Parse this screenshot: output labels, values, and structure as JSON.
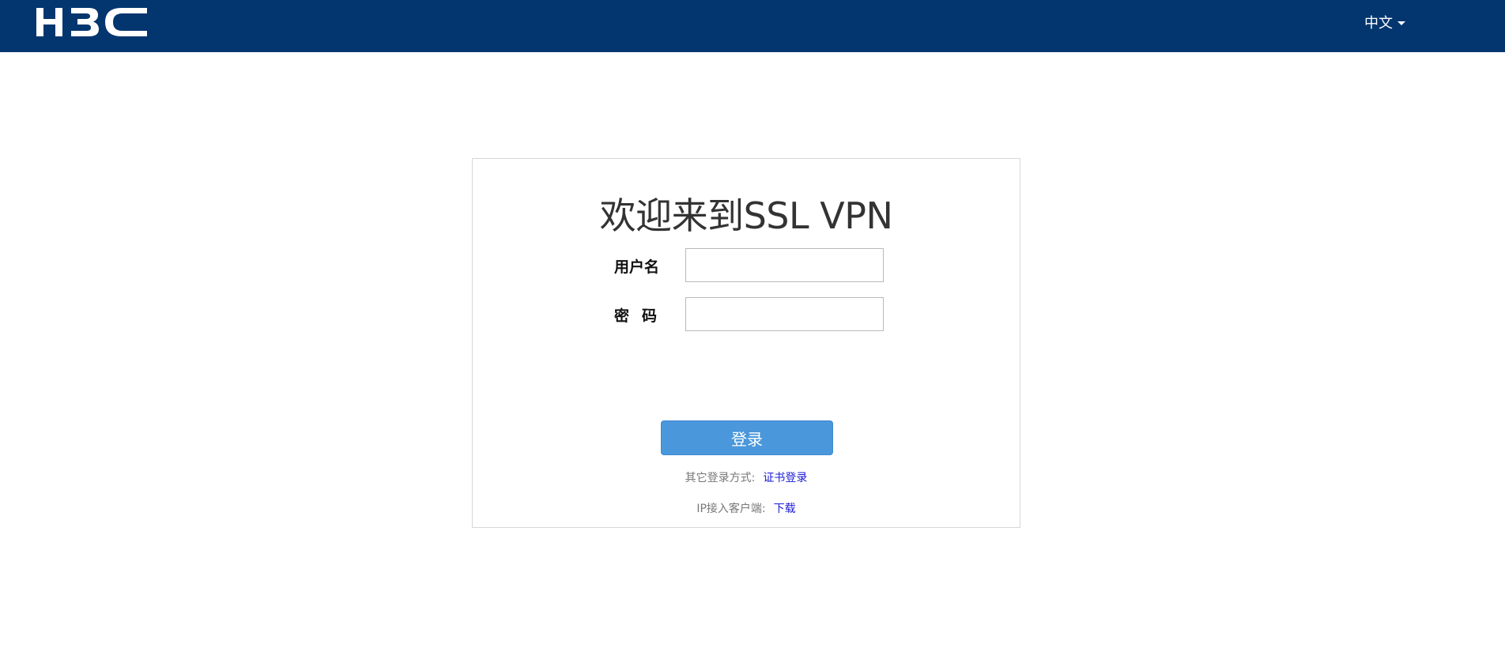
{
  "header": {
    "logo_text": "H3C",
    "language_label": "中文"
  },
  "login": {
    "title": "欢迎来到SSL VPN",
    "username_label": "用户名",
    "username_value": "",
    "password_label": "密码",
    "password_value": "",
    "submit_label": "登录",
    "alt_login_prefix": "其它登录方式:",
    "alt_login_link": "证书登录",
    "ip_client_prefix": "IP接入客户端:",
    "ip_client_link": "下载"
  },
  "colors": {
    "header_bg": "#03366e",
    "button_bg": "#4a97db",
    "link": "#1a1ad6"
  },
  "icons": [
    "caret-down-icon"
  ]
}
